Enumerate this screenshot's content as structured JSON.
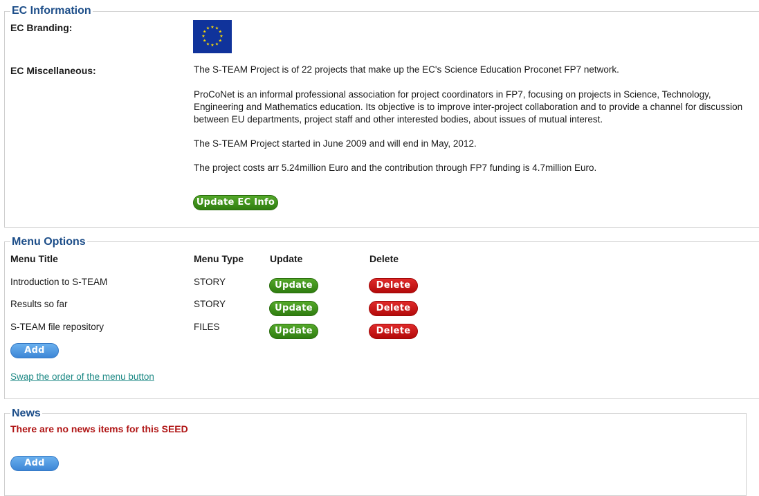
{
  "ec_information": {
    "legend": "EC Information",
    "branding_label": "EC Branding:",
    "branding_image": "eu-flag",
    "misc_label": "EC Miscellaneous:",
    "paragraphs": [
      "The S-TEAM Project is of 22 projects that make up the EC's Science Education Proconet FP7 network.",
      "ProCoNet is an informal professional association for project coordinators in FP7, focusing on projects in Science, Technology, Engineering and Mathematics education. Its objective is to improve inter-project collaboration and to provide a channel for discussion between EU departments, project staff and other interested bodies, about issues of mutual interest.",
      "The S-TEAM Project started in June 2009 and will end in May, 2012.",
      "The project costs arr 5.24million Euro and the contribution through FP7 funding is 4.7million Euro."
    ],
    "update_button": "Update EC Info"
  },
  "menu_options": {
    "legend": "Menu Options",
    "headers": {
      "title": "Menu Title",
      "type": "Menu Type",
      "update": "Update",
      "delete": "Delete"
    },
    "rows": [
      {
        "title": "Introduction to S-TEAM",
        "type": "STORY",
        "update": "Update",
        "delete": "Delete"
      },
      {
        "title": "Results so far",
        "type": "STORY",
        "update": "Update",
        "delete": "Delete"
      },
      {
        "title": "S-TEAM file repository",
        "type": "FILES",
        "update": "Update",
        "delete": "Delete"
      }
    ],
    "add_button": "Add",
    "swap_link": "Swap the order of the menu button"
  },
  "news": {
    "legend": "News",
    "empty_message": "There are no news items for this SEED",
    "add_button": "Add"
  },
  "colors": {
    "legend": "#1d4e89",
    "green_button": "#3f9019",
    "red_button": "#c81414",
    "blue_button": "#4c94df",
    "link": "#1f8a86",
    "warning": "#b01515"
  }
}
